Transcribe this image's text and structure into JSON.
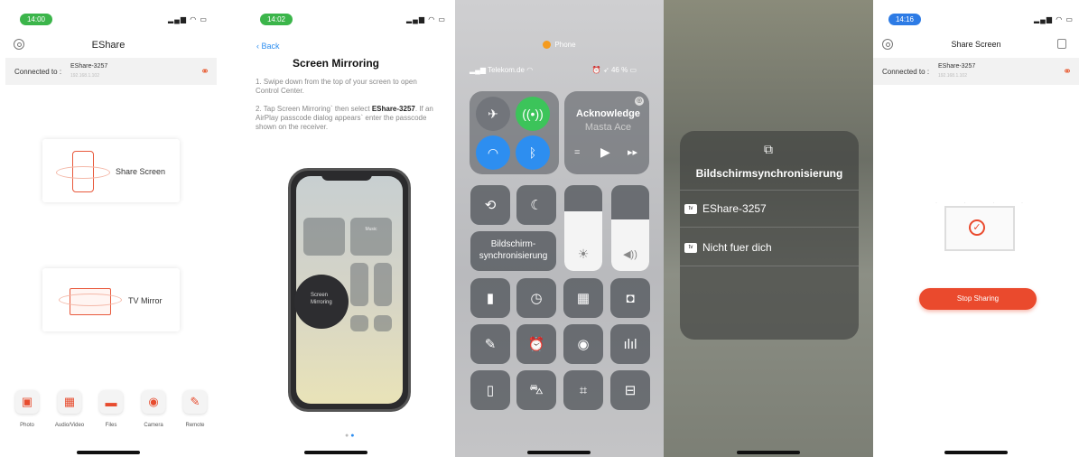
{
  "panel1": {
    "time": "14:00",
    "title": "EShare",
    "connected_label": "Connected to :",
    "device_name": "EShare-3257",
    "device_ip": "192.168.1.102",
    "share_screen": "Share Screen",
    "tv_mirror": "TV Mirror",
    "toolbar": [
      "Photo",
      "Audio/Video",
      "Files",
      "Camera",
      "Remote"
    ]
  },
  "panel2": {
    "time": "14:02",
    "back": "Back",
    "title": "Screen Mirroring",
    "step1": "1. Swipe down from the top of your screen to open Control Center.",
    "step2_pre": "2. Tap Screen Mirroring` then select",
    "step2_device": "EShare-3257",
    "step2_post": ". If an AirPlay passcode dialog appears` enter the passcode shown on the receiver.",
    "mini_music": "Music",
    "mirror_circle": "Screen Mirroring"
  },
  "panel3": {
    "top_app": "Phone",
    "carrier": "Telekom.de",
    "battery": "46 %",
    "music_title": "Acknowledge",
    "music_artist": "Masta Ace",
    "mirror_button": "Bildschirm-\nsynchronisierung"
  },
  "panel4": {
    "title": "Bildschirmsynchronisierung",
    "device1": "EShare-3257",
    "device2": "Nicht fuer dich"
  },
  "panel5": {
    "time": "14:16",
    "title": "Share Screen",
    "connected_label": "Connected to :",
    "device_name": "EShare-3257",
    "device_ip": "192.168.1.102",
    "stop_button": "Stop Sharing"
  },
  "colors": {
    "accent": "#ea4a2d",
    "ios_blue": "#2d8ef0",
    "green_pill": "#3bb54a",
    "blue_pill": "#2d7be5"
  }
}
